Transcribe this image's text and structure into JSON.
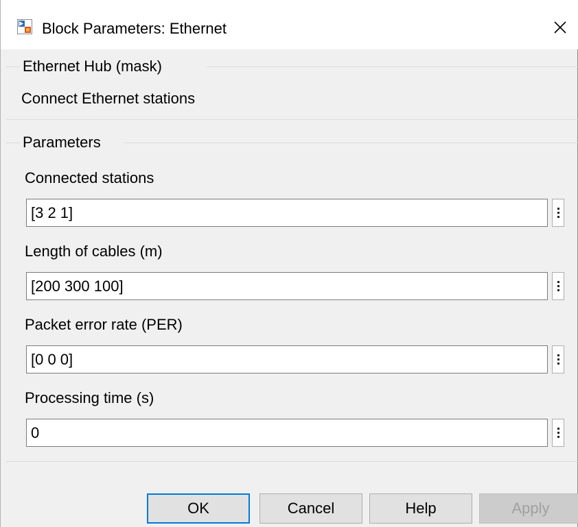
{
  "window": {
    "title": "Block Parameters: Ethernet"
  },
  "mask": {
    "group_title": "Ethernet Hub (mask)",
    "description": "Connect Ethernet stations"
  },
  "parameters": {
    "group_title": "Parameters",
    "fields": [
      {
        "label": "Connected stations",
        "value": "[3 2 1]"
      },
      {
        "label": "Length of cables (m)",
        "value": "[200 300 100]"
      },
      {
        "label": "Packet error rate (PER)",
        "value": "[0 0 0]"
      },
      {
        "label": "Processing time (s)",
        "value": "0"
      }
    ]
  },
  "buttons": {
    "ok": "OK",
    "cancel": "Cancel",
    "help": "Help",
    "apply": "Apply"
  },
  "colors": {
    "default_button_border": "#0078d7",
    "window_background": "#f0f0f0"
  },
  "icons": [
    "simulink-block-icon",
    "close-icon",
    "more-options-icon"
  ]
}
